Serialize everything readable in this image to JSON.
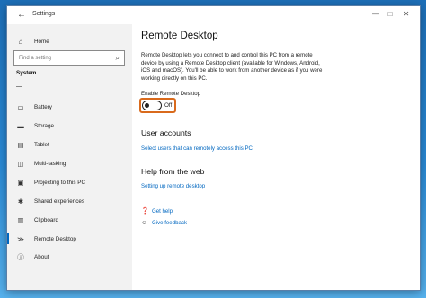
{
  "window": {
    "title": "Settings",
    "back_icon": "←",
    "minimize_icon": "—",
    "maximize_icon": "□",
    "close_icon": "✕"
  },
  "sidebar": {
    "home": {
      "icon": "⌂",
      "label": "Home"
    },
    "search": {
      "placeholder": "Find a setting",
      "icon": "⌕"
    },
    "section": "System",
    "items": [
      {
        "icon": "▭",
        "label": "Battery"
      },
      {
        "icon": "▬",
        "label": "Storage"
      },
      {
        "icon": "▤",
        "label": "Tablet"
      },
      {
        "icon": "◫",
        "label": "Multi-tasking"
      },
      {
        "icon": "▣",
        "label": "Projecting to this PC"
      },
      {
        "icon": "✱",
        "label": "Shared experiences"
      },
      {
        "icon": "▥",
        "label": "Clipboard"
      },
      {
        "icon": "≫",
        "label": "Remote Desktop"
      },
      {
        "icon": "ⓘ",
        "label": "About"
      }
    ],
    "selected_index": 7
  },
  "main": {
    "title": "Remote Desktop",
    "description": "Remote Desktop lets you connect to and control this PC from a remote device by using a Remote Desktop client (available for Windows, Android, iOS and macOS). You'll be able to work from another device as if you were working directly on this PC.",
    "toggle": {
      "label": "Enable Remote Desktop",
      "state": "Off"
    },
    "user_accounts": {
      "heading": "User accounts",
      "link": "Select users that can remotely access this PC"
    },
    "help": {
      "heading": "Help from the web",
      "link": "Setting up remote desktop"
    },
    "footer": [
      {
        "icon": "❓",
        "label": "Get help"
      },
      {
        "icon": "☺",
        "label": "Give feedback"
      }
    ]
  },
  "colors": {
    "accent": "#0067c0",
    "highlight": "#d96a1c"
  }
}
